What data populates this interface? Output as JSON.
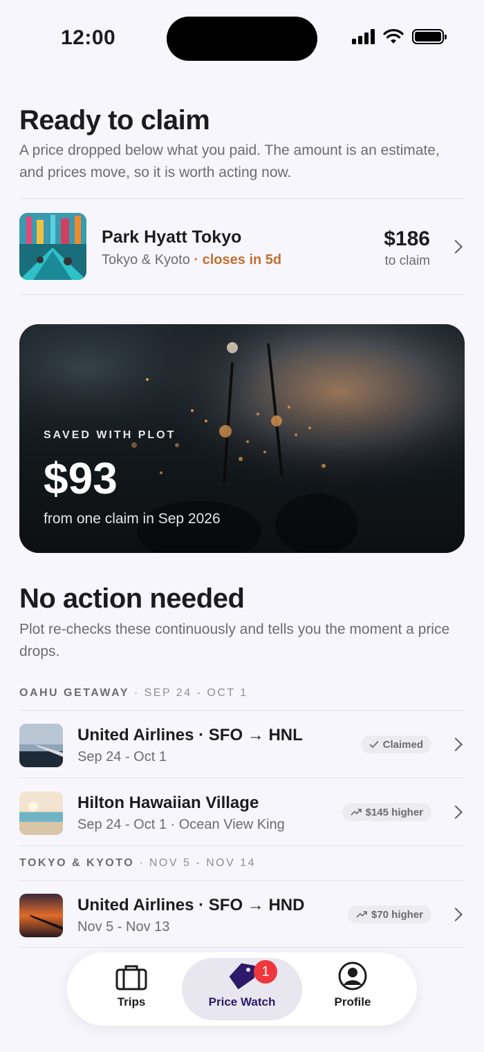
{
  "status_bar": {
    "time": "12:00"
  },
  "ready": {
    "title": "Ready to claim",
    "description": "A price dropped below what you paid. The amount is an estimate, and prices move, so it is worth acting now.",
    "item": {
      "title": "Park Hyatt Tokyo",
      "location": "Tokyo & Kyoto",
      "separator": " · ",
      "deadline": "closes in 5d",
      "amount": "$186",
      "amount_label": "to claim"
    }
  },
  "saved": {
    "label": "SAVED WITH PLOT",
    "amount": "$93",
    "description": "from one claim in Sep 2026"
  },
  "no_action": {
    "title": "No action needed",
    "description": "Plot re-checks these continuously and tells you the moment a price drops.",
    "groups": [
      {
        "name": "OAHU GETAWAY",
        "dates": " · SEP 24 - OCT 1",
        "items": [
          {
            "title": "United Airlines · SFO → HNL",
            "subtitle": "Sep 24 - Oct 1",
            "status": "Claimed",
            "status_icon": "check-icon"
          },
          {
            "title": "Hilton Hawaiian Village",
            "subtitle": "Sep 24 - Oct 1 · Ocean View King",
            "status": "$145 higher",
            "status_icon": "trend-up-icon"
          }
        ]
      },
      {
        "name": "TOKYO & KYOTO",
        "dates": " · NOV 5 - NOV 14",
        "items": [
          {
            "title": "United Airlines · SFO → HND",
            "subtitle": "Nov 5 - Nov 13",
            "status": "$70 higher",
            "status_icon": "trend-up-icon"
          }
        ]
      }
    ]
  },
  "tab_bar": {
    "tabs": [
      {
        "label": "Trips",
        "icon": "briefcase-icon"
      },
      {
        "label": "Price Watch",
        "icon": "price-tag-icon",
        "badge": "1",
        "active": true
      },
      {
        "label": "Profile",
        "icon": "person-circle-icon"
      }
    ]
  },
  "colors": {
    "background": "#f8f6fd",
    "warning": "#c0702e",
    "badge": "#f0373d",
    "active_tab_text": "#2d1a6b"
  }
}
